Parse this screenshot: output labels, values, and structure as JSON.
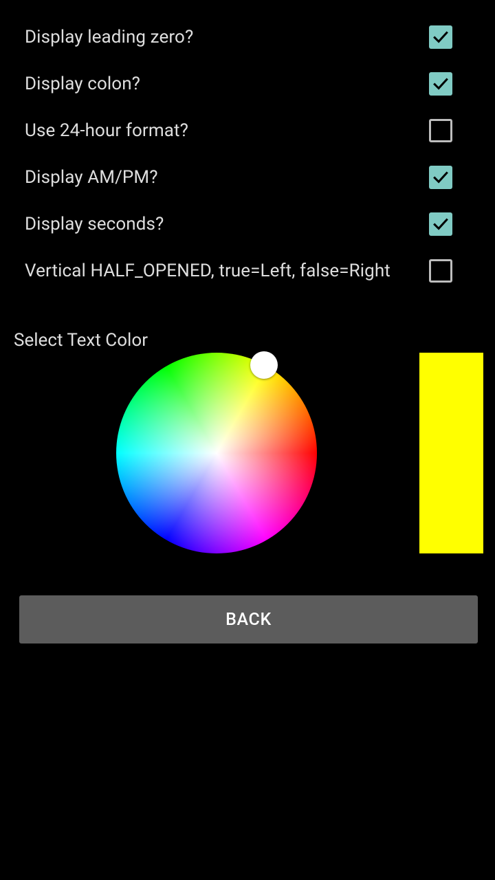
{
  "options": [
    {
      "label": "Display leading zero?",
      "checked": true
    },
    {
      "label": "Display colon?",
      "checked": true
    },
    {
      "label": "Use 24-hour format?",
      "checked": false
    },
    {
      "label": "Display AM/PM?",
      "checked": true
    },
    {
      "label": "Display seconds?",
      "checked": true
    },
    {
      "label": "Vertical HALF_OPENED, true=Left, false=Right",
      "checked": false
    }
  ],
  "color_picker": {
    "heading": "Select Text Color",
    "selected_color": "#ffff00"
  },
  "back_button": {
    "label": "BACK"
  },
  "colors": {
    "background": "#000000",
    "checkbox_accent": "#80cbc4",
    "checkbox_unchecked_border": "#bdbdbd",
    "button_background": "#5c5c5c"
  },
  "icons": {
    "checkmark": "check-icon"
  }
}
